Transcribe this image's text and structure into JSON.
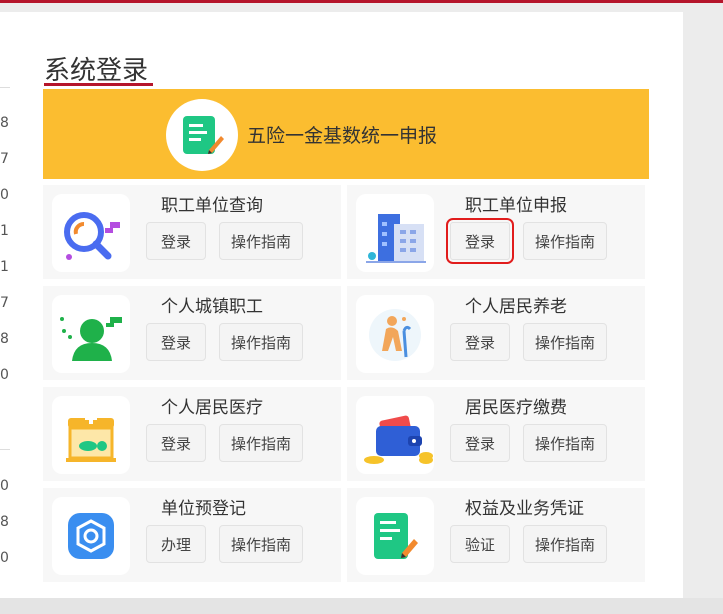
{
  "header": {
    "title": "系统登录"
  },
  "left_gutter": {
    "digits_top": [
      "8",
      "7",
      "0",
      "1",
      "1",
      "7",
      "8",
      "0"
    ],
    "digits_bottom": [
      "0",
      "8",
      "0"
    ]
  },
  "banner": {
    "label": "五险一金基数统一申报",
    "icon": "form-pen-icon"
  },
  "cards": [
    {
      "title": "职工单位查询",
      "primary": "登录",
      "guide": "操作指南",
      "icon": "magnifier-chart-icon"
    },
    {
      "title": "职工单位申报",
      "primary": "登录",
      "guide": "操作指南",
      "icon": "office-building-icon",
      "highlighted": true
    },
    {
      "title": "个人城镇职工",
      "primary": "登录",
      "guide": "操作指南",
      "icon": "person-silhouette-icon"
    },
    {
      "title": "个人居民养老",
      "primary": "登录",
      "guide": "操作指南",
      "icon": "elderly-person-icon"
    },
    {
      "title": "个人居民医疗",
      "primary": "登录",
      "guide": "操作指南",
      "icon": "pharmacy-store-icon"
    },
    {
      "title": "居民医疗缴费",
      "primary": "登录",
      "guide": "操作指南",
      "icon": "wallet-coins-icon"
    },
    {
      "title": "单位预登记",
      "primary": "办理",
      "guide": "操作指南",
      "icon": "gear-badge-icon"
    },
    {
      "title": "权益及业务凭证",
      "primary": "验证",
      "guide": "操作指南",
      "icon": "document-pen-icon"
    }
  ],
  "colors": {
    "accent_red": "#b5152b",
    "banner_yellow": "#fbbd30",
    "highlight_red": "#e11c1c"
  }
}
